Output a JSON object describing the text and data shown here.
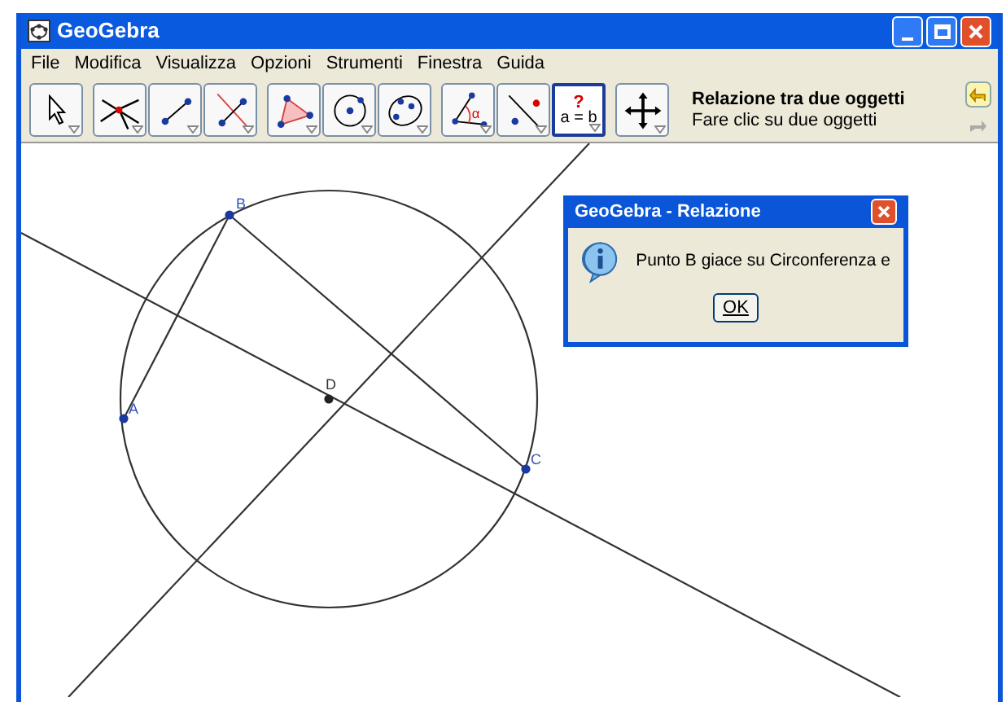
{
  "window": {
    "title": "GeoGebra"
  },
  "menu": [
    "File",
    "Modifica",
    "Visualizza",
    "Opzioni",
    "Strumenti",
    "Finestra",
    "Guida"
  ],
  "toolbar": {
    "groups": [
      [
        {
          "kind": "pointer",
          "selected": false
        }
      ],
      [
        {
          "kind": "intersect",
          "selected": false
        },
        {
          "kind": "segment",
          "selected": false
        },
        {
          "kind": "perpendicular",
          "selected": false
        }
      ],
      [
        {
          "kind": "polygon",
          "selected": false
        },
        {
          "kind": "circle",
          "selected": false
        },
        {
          "kind": "conic",
          "selected": false
        }
      ],
      [
        {
          "kind": "angle",
          "selected": false,
          "text": "α"
        },
        {
          "kind": "distance",
          "selected": false
        },
        {
          "kind": "relation",
          "selected": true,
          "text": "?",
          "text2": "a = b"
        }
      ],
      [
        {
          "kind": "move-view",
          "selected": false
        }
      ]
    ],
    "tool_name": "Relazione tra due oggetti",
    "tool_help": "Fare clic su due oggetti"
  },
  "canvas": {
    "points": [
      {
        "label": "A"
      },
      {
        "label": "B"
      },
      {
        "label": "C"
      },
      {
        "label": "D"
      }
    ]
  },
  "dialog": {
    "title": "GeoGebra - Relazione",
    "message": "Punto B giace su Circonferenza e",
    "button": "OK"
  }
}
